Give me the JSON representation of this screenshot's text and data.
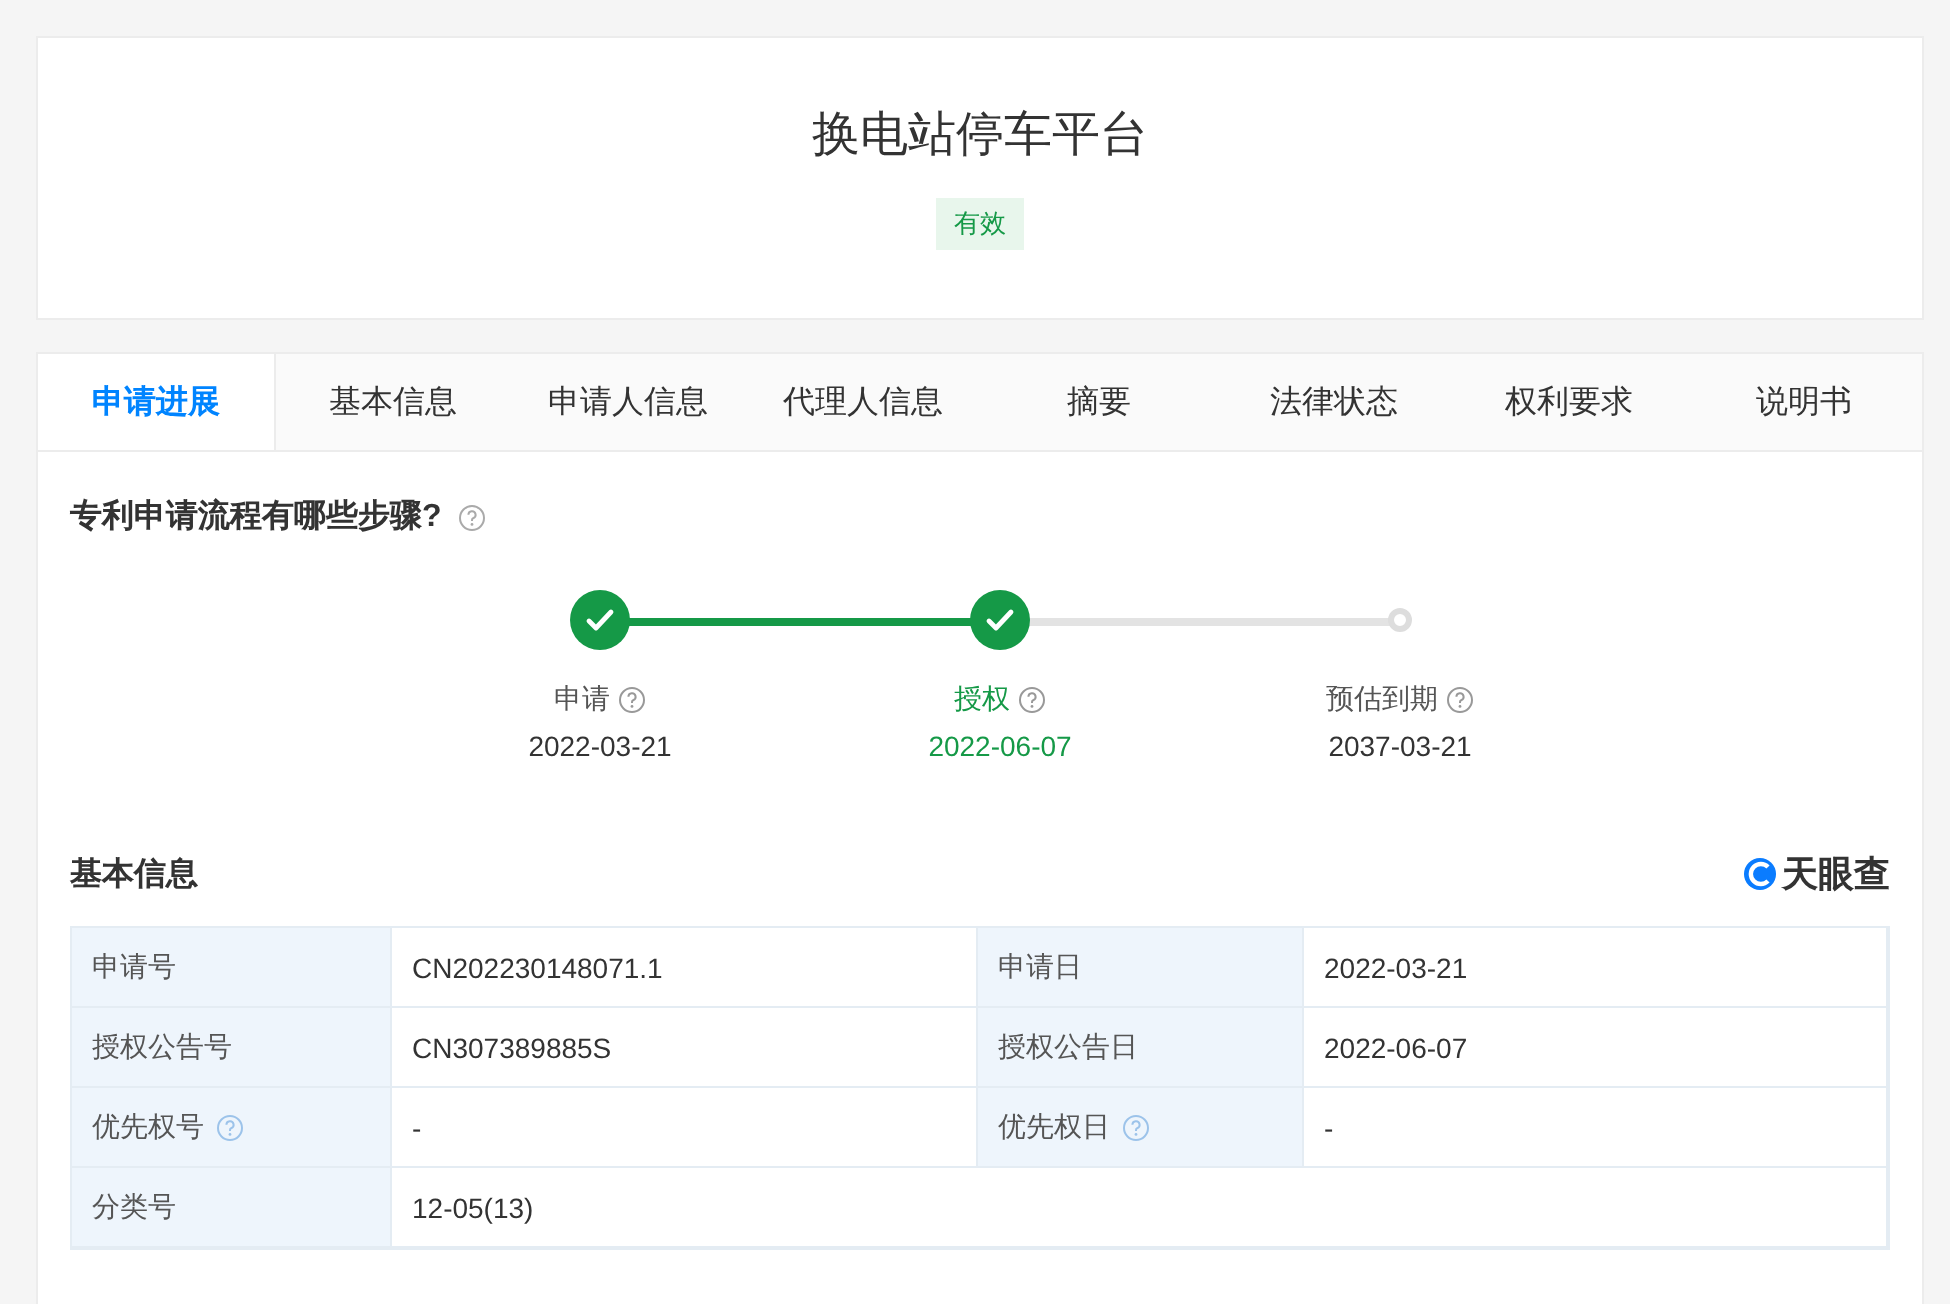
{
  "header": {
    "title": "换电站停车平台",
    "status_badge": "有效"
  },
  "tabs": [
    {
      "label": "申请进展",
      "selected": true
    },
    {
      "label": "基本信息",
      "selected": false
    },
    {
      "label": "申请人信息",
      "selected": false
    },
    {
      "label": "代理人信息",
      "selected": false
    },
    {
      "label": "摘要",
      "selected": false
    },
    {
      "label": "法律状态",
      "selected": false
    },
    {
      "label": "权利要求",
      "selected": false
    },
    {
      "label": "说明书",
      "selected": false
    }
  ],
  "progress": {
    "heading": "专利申请流程有哪些步骤?",
    "steps": [
      {
        "label": "申请",
        "date": "2022-03-21",
        "done": true,
        "selected": false
      },
      {
        "label": "授权",
        "date": "2022-06-07",
        "done": true,
        "selected": true
      },
      {
        "label": "预估到期",
        "date": "2037-03-21",
        "done": false,
        "selected": false
      }
    ]
  },
  "basic_info": {
    "heading": "基本信息",
    "source_logo": "天眼查",
    "rows": [
      [
        {
          "label": "申请号",
          "value": "CN202230148071.1",
          "help": false
        },
        {
          "label": "申请日",
          "value": "2022-03-21",
          "help": false
        }
      ],
      [
        {
          "label": "授权公告号",
          "value": "CN307389885S",
          "help": false
        },
        {
          "label": "授权公告日",
          "value": "2022-06-07",
          "help": false
        }
      ],
      [
        {
          "label": "优先权号",
          "value": "-",
          "help": true
        },
        {
          "label": "优先权日",
          "value": "-",
          "help": true
        }
      ],
      [
        {
          "label": "分类号",
          "value": "12-05(13)",
          "help": false
        }
      ]
    ]
  }
}
